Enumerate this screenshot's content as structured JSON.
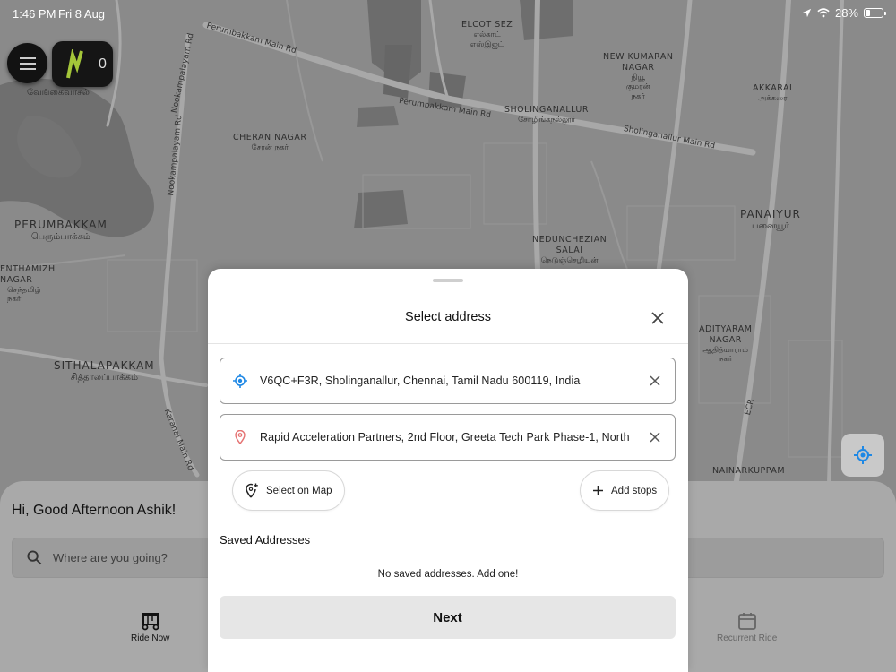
{
  "status_bar": {
    "time": "1:46 PM",
    "date": "Fri 8 Aug",
    "battery": "28%"
  },
  "map": {
    "places": [
      {
        "en": "ELCOT SEZ",
        "ta": "எல்காட்\nஎஸ்இஜட்"
      },
      {
        "en": "NEW KUMARAN\nNAGAR",
        "ta": "நியூ\nகுமரன்\nநகர்"
      },
      {
        "en": "AKKARAI",
        "ta": "அக்கரை"
      },
      {
        "en": "SHOLINGANALLUR",
        "ta": "சோழிங்கநல்லூர்"
      },
      {
        "en": "CHERAN NAGAR",
        "ta": "சேரன் நகர்"
      },
      {
        "en": "PERUMBAKKAM",
        "ta": "பெரும்பாக்கம்"
      },
      {
        "en": "PANAIYUR",
        "ta": "பனையூர்"
      },
      {
        "en": "NEDUNCHEZIAN\nSALAI",
        "ta": "நெடுஞ்செழியன்"
      },
      {
        "en": "ENTHAMIZH\nNAGAR",
        "ta": "செந்தமிழ்\nநகர்"
      },
      {
        "en": "ADITYARAM\nNAGAR",
        "ta": "ஆதித்யாராம்\nநகர்"
      },
      {
        "en": "SITHALAPAKKAM",
        "ta": "சித்தாலப்பாக்கம்"
      },
      {
        "en": "NAINARKUPPAM",
        "ta": ""
      },
      {
        "en": "",
        "ta": "வேங்கைவாசல்"
      }
    ],
    "roads": [
      "Perumbakkam Main Rd",
      "Nookampalayam Rd",
      "Nookampalayam Rd",
      "Perumbakkam Main Rd",
      "Sholinganallur Main Rd",
      "Karanai Main Rd",
      "ECR"
    ]
  },
  "top_controls": {
    "coin_count": "0"
  },
  "home": {
    "greeting": "Hi, Good Afternoon Ashik!",
    "search_placeholder": "Where are you going?",
    "tabs": [
      {
        "label": "Ride Now"
      },
      {
        "label": "Recurrent Ride"
      }
    ]
  },
  "sheet": {
    "title": "Select address",
    "pickup": "V6QC+F3R, Sholinganallur, Chennai, Tamil Nadu 600119, India",
    "drop": "Rapid Acceleration Partners, 2nd Floor, Greeta Tech Park Phase-1, North",
    "select_on_map": "Select on Map",
    "add_stops": "Add stops",
    "saved_heading": "Saved Addresses",
    "empty_message": "No saved addresses. Add one!",
    "next_label": "Next"
  },
  "colors": {
    "accent": "#1e88e5",
    "pin": "#e57373",
    "logo": "#a4c639"
  }
}
